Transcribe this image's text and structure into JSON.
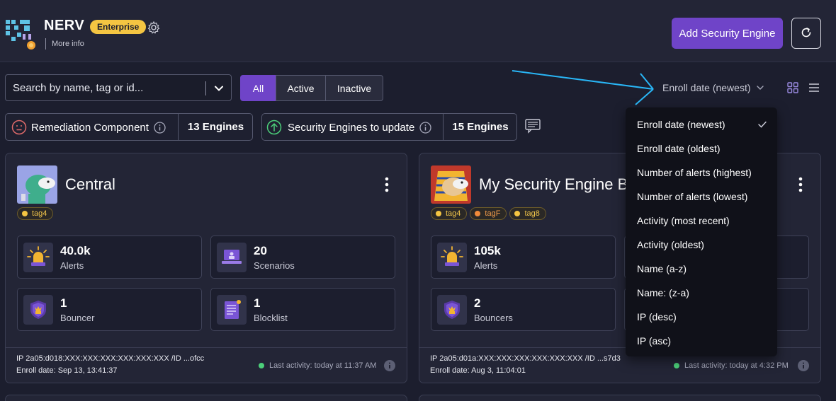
{
  "header": {
    "org_name": "NERV",
    "plan_badge": "Enterprise",
    "more_info": "More info",
    "add_button": "Add Security Engine"
  },
  "toolbar": {
    "search_placeholder": "Search by name, tag or id...",
    "filters": [
      "All",
      "Active",
      "Inactive"
    ],
    "selected_filter": "All",
    "sort_label": "Enroll date (newest)"
  },
  "stats": [
    {
      "label": "Remediation Component",
      "count": "13 Engines"
    },
    {
      "label": "Security Engines to update",
      "count": "15 Engines"
    }
  ],
  "cards": [
    {
      "title": "Central",
      "tags": [
        "tag4"
      ],
      "metrics": [
        {
          "value": "40.0k",
          "label": "Alerts"
        },
        {
          "value": "20",
          "label": "Scenarios"
        },
        {
          "value": "1",
          "label": "Bouncer"
        },
        {
          "value": "1",
          "label": "Blocklist"
        }
      ],
      "ip": "IP 2a05:d018:XXX:XXX:XXX:XXX:XXX:XXX /ID ...ofcc",
      "enroll": "Enroll date: Sep 13, 13:41:37",
      "last_activity": "Last activity: today at 11:37 AM"
    },
    {
      "title": "My Security Engine BE",
      "tags": [
        "tag4",
        "tagF",
        "tag8"
      ],
      "metrics": [
        {
          "value": "105k",
          "label": "Alerts"
        },
        {
          "value": "2",
          "label": "Bouncers"
        }
      ],
      "ip": "IP 2a05:d01a:XXX:XXX:XXX:XXX:XXX:XXX /ID ...s7d3",
      "enroll": "Enroll date: Aug 3, 11:04:01",
      "last_activity": "Last activity: today at 4:32 PM"
    }
  ],
  "sort_menu": {
    "selected": "Enroll date (newest)",
    "options": [
      "Enroll date (newest)",
      "Enroll date (oldest)",
      "Number of alerts (highest)",
      "Number of alerts (lowest)",
      "Activity (most recent)",
      "Activity (oldest)",
      "Name (a-z)",
      "Name: (z-a)",
      "IP (desc)",
      "IP (asc)"
    ]
  },
  "colors": {
    "background": "#1c1e2e",
    "accent": "#6f44c8",
    "badge": "#f4c542",
    "annotation_arrow": "#29b6f6",
    "status_online": "#4cd07a"
  }
}
